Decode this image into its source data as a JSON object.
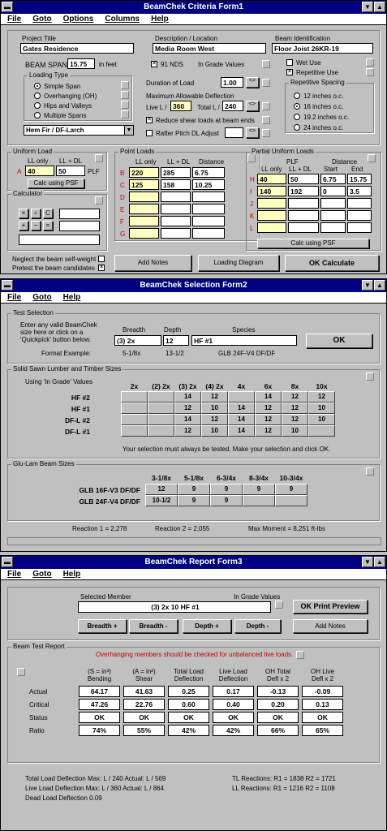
{
  "f1": {
    "title": "BeamChek   Criteria Form1",
    "menu": [
      "File",
      "Goto",
      "Options",
      "Columns",
      "Help"
    ],
    "project_title_label": "Project Title",
    "project_title": "Gates Residence",
    "description_label": "Description / Location",
    "description": "Media Room West",
    "beam_id_label": "Beam Identification",
    "beam_id": "Floor Joist 26KR-19",
    "beam_span_label": "BEAM SPAN",
    "beam_span": "15.75",
    "in_feet": "in feet",
    "nds": "91 NDS",
    "grade_values": "In Grade Values",
    "wet_use": "Wet Use",
    "repetitive_use": "Repetitive Use",
    "loading_type_label": "Loading Type",
    "loading_types": [
      "Simple Span",
      "Overhanging (OH)",
      "Hips and Valleys",
      "Multiple Spans"
    ],
    "species": "Hem Fir / DF-Larch",
    "duration_label": "Duration of Load",
    "duration": "1.00",
    "max_defl_label": "Maximum Allowable Deflection",
    "live_l_label": "Live L /",
    "live_l": "360",
    "total_l_label": "Total L /",
    "total_l": "240",
    "reduce_shear": "Reduce shear loads at beam ends",
    "rafter_pitch": "Rafter Pitch DL Adjust",
    "rep_spacing_label": "Repetitive Spacing",
    "rep_spacing": [
      "12 inches o.c.",
      "16 inches o.c.",
      "19.2 inches o.c.",
      "24 inches o.c."
    ],
    "uniform_load_label": "Uniform Load",
    "ll_only": "LL only",
    "ll_dl": "LL + DL",
    "row_a": "A",
    "ul_ll": "40",
    "ul_dl": "50",
    "plf": "PLF",
    "calc_psf": "Calc using PSF",
    "point_loads_label": "Point Loads",
    "distance": "Distance",
    "rows": [
      "B",
      "C",
      "D",
      "E",
      "F",
      "G"
    ],
    "point_loads": [
      [
        "220",
        "285",
        "6.75"
      ],
      [
        "125",
        "158",
        "10.25"
      ],
      [
        "",
        "",
        ""
      ],
      [
        "",
        "",
        ""
      ],
      [
        "",
        "",
        ""
      ],
      [
        "",
        "",
        ""
      ]
    ],
    "partial_label": "Partial Uniform Loads",
    "plf_hdr": "PLF",
    "start": "Start",
    "end": "End",
    "partial_rows": [
      "H",
      "I",
      "J",
      "K",
      "L"
    ],
    "partial_loads": [
      [
        "40",
        "50",
        "6.75",
        "15.75"
      ],
      [
        "140",
        "192",
        "0",
        "3.5"
      ],
      [
        "",
        "",
        "",
        ""
      ],
      [
        "",
        "",
        "",
        ""
      ],
      [
        "",
        "",
        "",
        ""
      ]
    ],
    "calculator_label": "Calculator",
    "calc_keys": [
      "×",
      "÷",
      "C",
      "+",
      "−",
      "="
    ],
    "neglect": "Neglect the beam self-weight",
    "pretest": "Pretest the beam candidates",
    "add_notes": "Add Notes",
    "loading_diagram": "Loading Diagram",
    "ok_calc": "OK Calculate"
  },
  "f2": {
    "title": "BeamChek   Selection Form2",
    "menu": [
      "File",
      "Goto",
      "Help"
    ],
    "test_selection_label": "Test Selection",
    "instructions": [
      "Enter any valid BeamChek",
      "size here or click on a",
      "'Quickpick' button below."
    ],
    "breadth_label": "Breadth",
    "depth_label": "Depth",
    "species_label": "Species",
    "breadth": "(3) 2x",
    "depth": "12",
    "species": "HF #1",
    "ok": "OK",
    "format_example": "Format Example:",
    "ex_breadth": "5-1/8x",
    "ex_depth": "13-1/2",
    "ex_species": "GLB 24F-V4 DF/DF",
    "solid_label": "Solid Sawn Lumber and Timber Sizes",
    "using_grade": "Using 'In Grade' Values",
    "solid_cols": [
      "2x",
      "(2) 2x",
      "(3) 2x",
      "(4) 2x",
      "4x",
      "6x",
      "8x",
      "10x"
    ],
    "solid_rows": [
      {
        "name": "HF #2",
        "cells": [
          "",
          "",
          "14",
          "12",
          "",
          "14",
          "12",
          "12"
        ]
      },
      {
        "name": "HF #1",
        "cells": [
          "",
          "",
          "12",
          "10",
          "14",
          "12",
          "12",
          "10"
        ]
      },
      {
        "name": "DF-L #2",
        "cells": [
          "",
          "",
          "14",
          "12",
          "14",
          "12",
          "12",
          "10"
        ]
      },
      {
        "name": "DF-L #1",
        "cells": [
          "",
          "",
          "12",
          "10",
          "14",
          "12",
          "10",
          ""
        ]
      }
    ],
    "must_test": "Your selection must always be tested. Make your selection and click OK.",
    "glulam_label": "Glu-Lam Beam Sizes",
    "glulam_cols": [
      "3-1/8x",
      "5-1/8x",
      "6-3/4x",
      "8-3/4x",
      "10-3/4x"
    ],
    "glulam_rows": [
      {
        "name": "GLB 16F-V3 DF/DF",
        "cells": [
          "12",
          "9",
          "9",
          "9",
          "9"
        ]
      },
      {
        "name": "GLB 24F-V4 DF/DF",
        "cells": [
          "10-1/2",
          "9",
          "9",
          "",
          ""
        ]
      }
    ],
    "reaction1": "Reaction 1 = 2,278",
    "reaction2": "Reaction 2 = 2,055",
    "max_moment": "Max Moment = 8,251 ft-lbs"
  },
  "f3": {
    "title": "BeamChek   Report Form3",
    "menu": [
      "File",
      "Goto",
      "Help"
    ],
    "selected_label": "Selected Member",
    "grade_values": "In Grade Values",
    "selected": "(3) 2x 10  HF #1",
    "ok_preview": "OK  Print Preview",
    "breadth_up": "Breadth +",
    "breadth_dn": "Breadth -",
    "depth_up": "Depth +",
    "depth_dn": "Depth -",
    "add_notes": "Add Notes",
    "report_label": "Beam Test Report",
    "overhang_warn": "Overhanging members should be checked for unbalanced live loads.",
    "cols": [
      [
        "(S = in³)",
        "Bending"
      ],
      [
        "(A = in²)",
        "Shear"
      ],
      [
        "Total Load",
        "Deflection"
      ],
      [
        "Live Load",
        "Deflection"
      ],
      [
        "OH Total",
        "Defl x 2"
      ],
      [
        "OH Live",
        "Defl x 2"
      ]
    ],
    "rows": [
      {
        "name": "Actual",
        "cells": [
          "64.17",
          "41.63",
          "0.25",
          "0.17",
          "-0.13",
          "-0.09"
        ]
      },
      {
        "name": "Critical",
        "cells": [
          "47.26",
          "22.76",
          "0.60",
          "0.40",
          "0.20",
          "0.13"
        ]
      },
      {
        "name": "Status",
        "cells": [
          "OK",
          "OK",
          "OK",
          "OK",
          "OK",
          "OK"
        ]
      },
      {
        "name": "Ratio",
        "cells": [
          "74%",
          "55%",
          "42%",
          "42%",
          "66%",
          "65%"
        ]
      }
    ],
    "tld": "Total Load Deflection   Max: L / 240   Actual: L / 569",
    "lld": "Live Load Deflection    Max: L / 360   Actual: L / 864",
    "dld": "Dead Load Deflection  0.09",
    "tl_react": "TL Reactions:  R1 = 1838  R2 = 1721",
    "ll_react": "LL Reactions:  R1 = 1216  R2 = 1108"
  }
}
